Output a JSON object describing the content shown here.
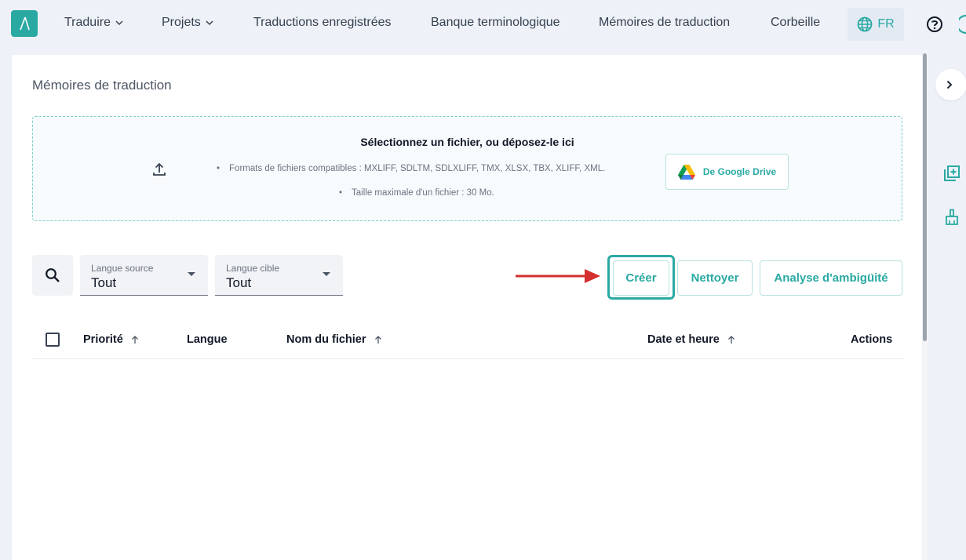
{
  "nav": {
    "items": [
      {
        "label": "Traduire",
        "has_dropdown": true
      },
      {
        "label": "Projets",
        "has_dropdown": true
      },
      {
        "label": "Traductions enregistrées",
        "has_dropdown": false
      },
      {
        "label": "Banque terminologique",
        "has_dropdown": false
      },
      {
        "label": "Mémoires de traduction",
        "has_dropdown": false
      },
      {
        "label": "Corbeille",
        "has_dropdown": false
      }
    ],
    "language": "FR",
    "logo_icon": "lambda-logo-icon",
    "help_icon": "help-circle-icon"
  },
  "page": {
    "title": "Mémoires de traduction"
  },
  "dropzone": {
    "title": "Sélectionnez un fichier, ou déposez-le ici",
    "formats": "Formats de fichiers compatibles : MXLIFF, SDLTM, SDLXLIFF, TMX, XLSX, TBX, XLIFF, XML.",
    "max_size": "Taille maximale d'un fichier : 30 Mo.",
    "drive_button": "De Google Drive",
    "upload_icon": "upload-icon",
    "drive_icon": "google-drive-icon"
  },
  "filters": {
    "source": {
      "label": "Langue source",
      "value": "Tout"
    },
    "target": {
      "label": "Langue cible",
      "value": "Tout"
    }
  },
  "actions": {
    "create": "Créer",
    "clean": "Nettoyer",
    "ambiguity": "Analyse d'ambigüité"
  },
  "table": {
    "columns": {
      "priority": "Priorité",
      "language": "Langue",
      "filename": "Nom du fichier",
      "datetime": "Date et heure",
      "actions": "Actions"
    },
    "rows": []
  },
  "colors": {
    "accent": "#2aa9a3",
    "annotation_arrow": "#d32f2f"
  }
}
